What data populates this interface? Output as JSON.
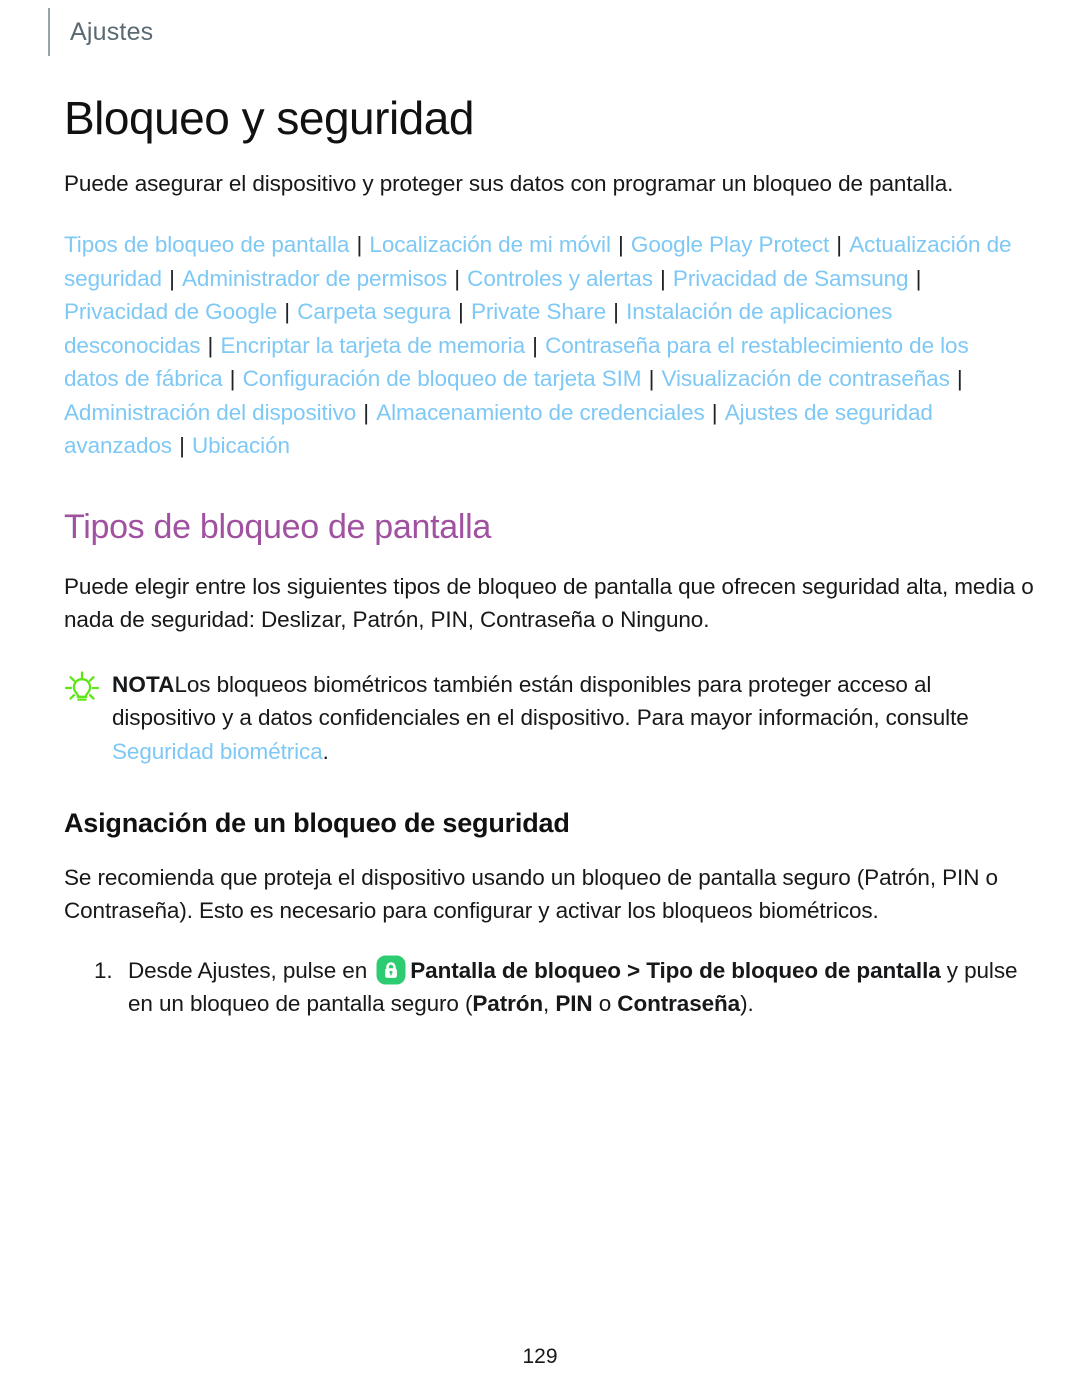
{
  "header": {
    "running_label": "Ajustes"
  },
  "page": {
    "title": "Bloqueo y seguridad",
    "intro": "Puede asegurar el dispositivo y proteger sus datos con programar un bloqueo de pantalla.",
    "page_number": "129"
  },
  "link_index": {
    "separator": "|",
    "links": [
      "Tipos de bloqueo de pantalla",
      "Localización de mi móvil",
      "Google Play Protect",
      "Actualización de seguridad",
      "Administrador de permisos",
      "Controles y alertas",
      "Privacidad de Samsung",
      "Privacidad de Google",
      "Carpeta segura",
      "Private Share",
      "Instalación de aplicaciones desconocidas",
      "Encriptar la tarjeta de memoria",
      "Contraseña para el restablecimiento de los datos de fábrica",
      "Configuración de bloqueo de tarjeta SIM",
      "Visualización de contraseñas",
      "Administración del dispositivo",
      "Almacenamiento de credenciales",
      "Ajustes de seguridad avanzados",
      "Ubicación"
    ]
  },
  "section": {
    "heading": "Tipos de bloqueo de pantalla",
    "paragraph": "Puede elegir entre los siguientes tipos de bloqueo de pantalla que ofrecen seguridad alta, media o nada de seguridad: Deslizar, Patrón, PIN, Contraseña o Ninguno."
  },
  "note": {
    "icon": "lightbulb-icon",
    "label": "NOTA",
    "text_before_link": "Los bloqueos biométricos también están disponibles para proteger acceso al dispositivo y a datos confidenciales en el dispositivo. Para mayor información, consulte ",
    "link": "Seguridad biométrica",
    "text_after_link": "."
  },
  "subsection": {
    "heading": "Asignación de un bloqueo de seguridad",
    "paragraph": "Se recomienda que proteja el dispositivo usando un bloqueo de pantalla seguro (Patrón, PIN o Contraseña). Esto es necesario para configurar y activar los bloqueos biométricos."
  },
  "steps": [
    {
      "number": "1.",
      "text_before_icon": "Desde Ajustes, pulse en ",
      "icon": "lock-screen-app-icon",
      "bold_path": "Pantalla de bloqueo > Tipo de bloqueo de pantalla",
      "text_after_path": " y pulse en un bloqueo de pantalla seguro (",
      "bold_option_1": "Patrón",
      "text_mid_1": ", ",
      "bold_option_2": "PIN",
      "text_mid_2": " o ",
      "bold_option_3": "Contraseña",
      "text_end": ")."
    }
  ],
  "colors": {
    "link_blue": "#7ec8f5",
    "heading_purple": "#a0519f",
    "note_icon_green": "#5ee617",
    "app_icon_green": "#2ecc71",
    "header_gray": "#5b6a72",
    "body_black": "#17181a"
  }
}
